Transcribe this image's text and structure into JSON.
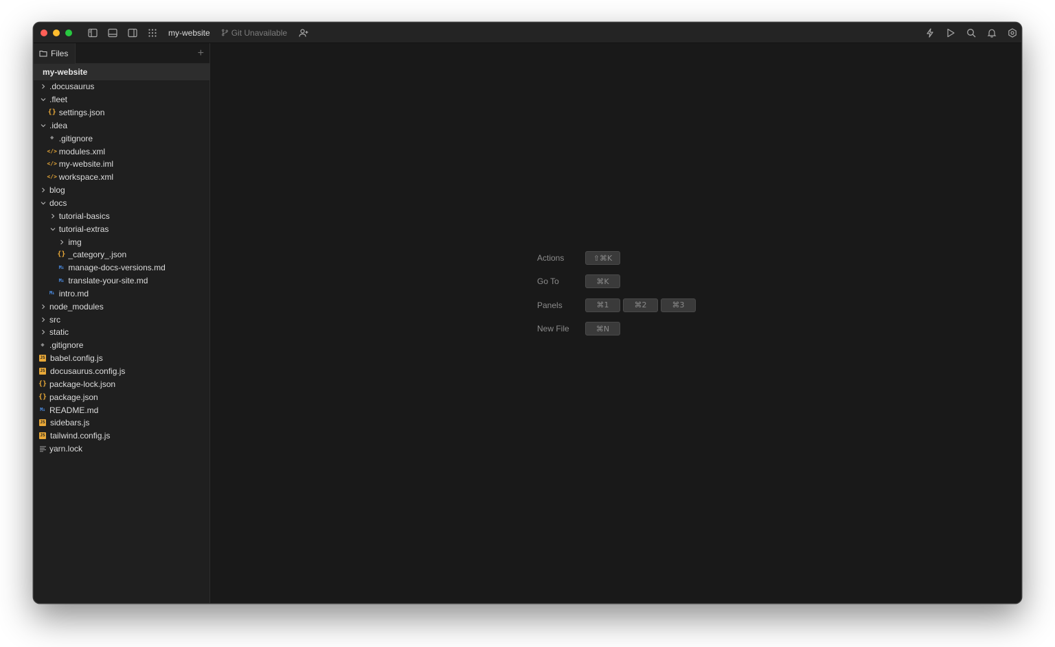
{
  "titlebar": {
    "project_name": "my-website",
    "git_status": "Git Unavailable"
  },
  "sidebar": {
    "tab_label": "Files",
    "add_label": "+",
    "root_label": "my-website",
    "tree": [
      {
        "label": ".docusaurus",
        "depth": 0,
        "kind": "folder",
        "expanded": false
      },
      {
        "label": ".fleet",
        "depth": 0,
        "kind": "folder",
        "expanded": true
      },
      {
        "label": "settings.json",
        "depth": 1,
        "kind": "json"
      },
      {
        "label": ".idea",
        "depth": 0,
        "kind": "folder",
        "expanded": true
      },
      {
        "label": ".gitignore",
        "depth": 1,
        "kind": "git"
      },
      {
        "label": "modules.xml",
        "depth": 1,
        "kind": "xml"
      },
      {
        "label": "my-website.iml",
        "depth": 1,
        "kind": "xml"
      },
      {
        "label": "workspace.xml",
        "depth": 1,
        "kind": "xml"
      },
      {
        "label": "blog",
        "depth": 0,
        "kind": "folder",
        "expanded": false
      },
      {
        "label": "docs",
        "depth": 0,
        "kind": "folder",
        "expanded": true
      },
      {
        "label": "tutorial-basics",
        "depth": 1,
        "kind": "folder",
        "expanded": false
      },
      {
        "label": "tutorial-extras",
        "depth": 1,
        "kind": "folder",
        "expanded": true
      },
      {
        "label": "img",
        "depth": 2,
        "kind": "folder",
        "expanded": false
      },
      {
        "label": "_category_.json",
        "depth": 2,
        "kind": "json"
      },
      {
        "label": "manage-docs-versions.md",
        "depth": 2,
        "kind": "md"
      },
      {
        "label": "translate-your-site.md",
        "depth": 2,
        "kind": "md"
      },
      {
        "label": "intro.md",
        "depth": 1,
        "kind": "md"
      },
      {
        "label": "node_modules",
        "depth": 0,
        "kind": "folder",
        "expanded": false
      },
      {
        "label": "src",
        "depth": 0,
        "kind": "folder",
        "expanded": false
      },
      {
        "label": "static",
        "depth": 0,
        "kind": "folder",
        "expanded": false
      },
      {
        "label": ".gitignore",
        "depth": 0,
        "kind": "git"
      },
      {
        "label": "babel.config.js",
        "depth": 0,
        "kind": "js"
      },
      {
        "label": "docusaurus.config.js",
        "depth": 0,
        "kind": "js"
      },
      {
        "label": "package-lock.json",
        "depth": 0,
        "kind": "json"
      },
      {
        "label": "package.json",
        "depth": 0,
        "kind": "json"
      },
      {
        "label": "README.md",
        "depth": 0,
        "kind": "md"
      },
      {
        "label": "sidebars.js",
        "depth": 0,
        "kind": "js"
      },
      {
        "label": "tailwind.config.js",
        "depth": 0,
        "kind": "js"
      },
      {
        "label": "yarn.lock",
        "depth": 0,
        "kind": "lock"
      }
    ]
  },
  "shortcuts": [
    {
      "label": "Actions",
      "keys": [
        "⇧⌘K"
      ]
    },
    {
      "label": "Go To",
      "keys": [
        "⌘K"
      ]
    },
    {
      "label": "Panels",
      "keys": [
        "⌘1",
        "⌘2",
        "⌘3"
      ]
    },
    {
      "label": "New File",
      "keys": [
        "⌘N"
      ]
    }
  ],
  "colors": {
    "accent_json": "#e8a838",
    "accent_md": "#4c8fe8",
    "window_bg": "#191919",
    "sidebar_bg": "#1f1f1f"
  }
}
